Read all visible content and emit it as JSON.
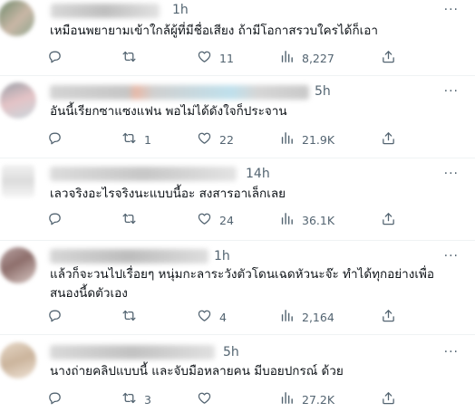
{
  "posts": [
    {
      "time": "1h",
      "more": "···",
      "text": "เหมือนพยายามเข้าใกล้ผู้ที่มีชื่อเสียง ถ้ามีโอกาสรวบใครได้ก็เอา",
      "replies": "",
      "reposts": "",
      "likes": "11",
      "views": "8,227"
    },
    {
      "time": "5h",
      "more": "···",
      "text": "อันนี้เรียกซาแซงแฟน พอไม่ได้ดังใจก็ประจาน",
      "replies": "",
      "reposts": "1",
      "likes": "22",
      "views": "21.9K"
    },
    {
      "time": "14h",
      "more": "···",
      "text": "เลวจริงอะไรจริงนะแบบนี้อะ สงสารอาเล็กเลย",
      "replies": "",
      "reposts": "",
      "likes": "24",
      "views": "36.1K"
    },
    {
      "time": "1h",
      "more": "···",
      "text": "แล้วก็จะวนไปเรื่อยๆ หนุ่มกะลาระวังตัวโดนเฉดหัวนะจ๊ะ ทำได้ทุกอย่างเพื่อสนองนี้ดตัวเอง",
      "replies": "",
      "reposts": "",
      "likes": "4",
      "views": "2,164"
    },
    {
      "time": "5h",
      "more": "···",
      "text": "นางถ่ายคลิปแบบนี้ และจับมือหลายคน มีบอยปกรณ์ ด้วย",
      "replies": "",
      "reposts": "3",
      "likes": "",
      "views": "27.2K"
    }
  ],
  "icons": {
    "reply": "reply-icon",
    "repost": "repost-icon",
    "like": "heart-icon",
    "views": "views-icon",
    "share": "share-icon"
  },
  "colors": {
    "text": "#0f1419",
    "muted": "#536471",
    "divider": "#eff3f4"
  }
}
